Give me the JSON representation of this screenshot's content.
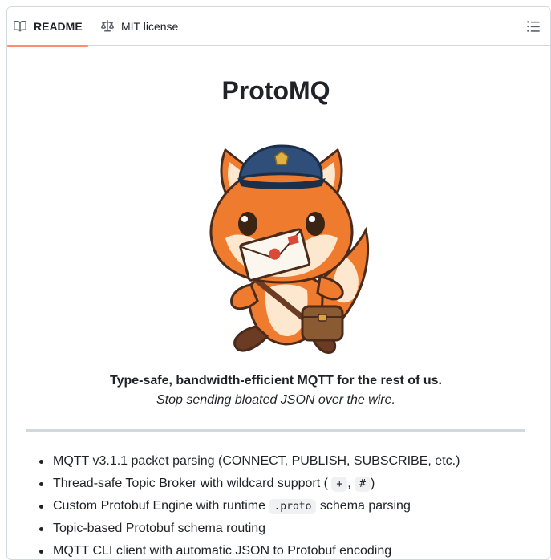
{
  "tabs": {
    "readme": "README",
    "license": "MIT license"
  },
  "readme": {
    "title": "ProtoMQ",
    "tagline": "Type-safe, bandwidth-efficient MQTT for the rest of us.",
    "subline": "Stop sending bloated JSON over the wire.",
    "features": {
      "f1": "MQTT v3.1.1 packet parsing (CONNECT, PUBLISH, SUBSCRIBE, etc.)",
      "f2_pre": "Thread-safe Topic Broker with wildcard support (",
      "f2_code1": "+",
      "f2_sep": ",",
      "f2_code2": "#",
      "f2_post": ")",
      "f3_pre": "Custom Protobuf Engine with runtime",
      "f3_code": ".proto",
      "f3_post": "schema parsing",
      "f4": "Topic-based Protobuf schema routing",
      "f5": "MQTT CLI client with automatic JSON to Protobuf encoding"
    }
  },
  "colors": {
    "active_tab_underline": "#fd8c73",
    "border": "#d1d9e0",
    "text": "#1f2328"
  },
  "icons": {
    "readme_tab": "book-icon",
    "license_tab": "law-scale-icon",
    "outline": "list-unordered-icon",
    "mascot": "fox-mail-carrier-mascot"
  }
}
